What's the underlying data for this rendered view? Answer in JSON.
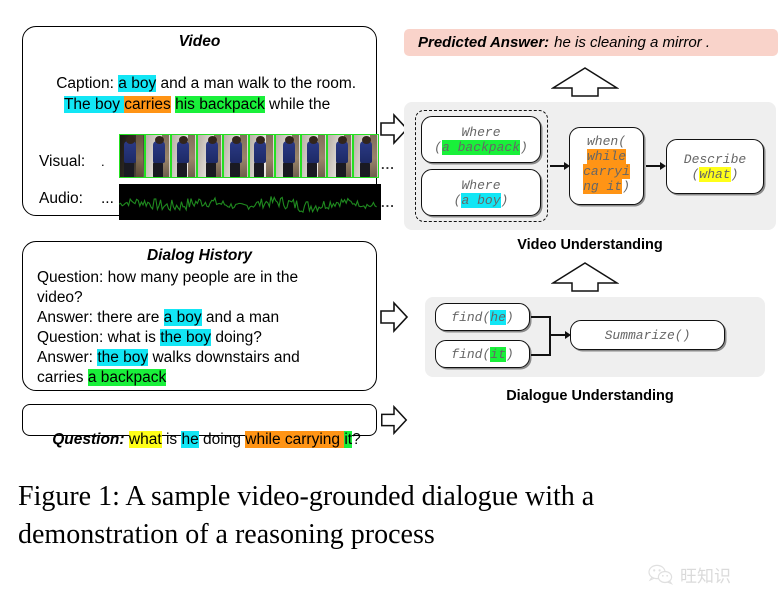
{
  "video_panel": {
    "title": "Video",
    "caption_label": "Caption:",
    "caption_line1_pre": "Caption: ",
    "caption_seg1": "a boy",
    "caption_seg2": " and a man walk to the room.",
    "caption_line2_seg1": "The boy ",
    "caption_line2_seg2": "carries",
    "caption_line2_seg3": " ",
    "caption_line2_seg4": "his backpack",
    "caption_line2_seg5": " while the",
    "visual_label": "Visual:",
    "visual_prefix_dots": ".",
    "visual_trailing_dots": "...",
    "audio_label": "Audio:",
    "audio_value": "...",
    "audio_trailing_dots": "..."
  },
  "dialog_panel": {
    "title": "Dialog History",
    "lines": [
      {
        "id": "q1",
        "prefix": "Question: how many people are in the"
      },
      {
        "id": "q1b",
        "prefix": "video?"
      },
      {
        "id": "a1",
        "prefix": "Answer: there are ",
        "hl": "a boy",
        "hl_color": "cyan",
        "suffix": " and a man"
      },
      {
        "id": "q2",
        "prefix": "Question: what is ",
        "hl": "the boy",
        "hl_color": "cyan",
        "suffix": " doing?"
      },
      {
        "id": "a2",
        "prefix": "Answer: ",
        "hl": "the boy",
        "hl_color": "cyan",
        "suffix": " walks downstairs and"
      },
      {
        "id": "a2b",
        "prefix": "carries ",
        "hl": "a backpack",
        "hl_color": "green",
        "suffix": ""
      }
    ]
  },
  "question_panel": {
    "label": "Question:",
    "seg_what": "what",
    "seg_is": " is ",
    "seg_he": "he",
    "seg_doing": " doing ",
    "seg_while": "while carrying ",
    "seg_it": "it",
    "seg_q": "?"
  },
  "predicted": {
    "label": "Predicted Answer:",
    "answer": "he is cleaning a mirror ."
  },
  "video_understanding": {
    "caption": "Video Understanding",
    "nodes": [
      {
        "id": "where-backpack",
        "line1": "Where",
        "line2_open": "(",
        "line2_hl": "a backpack",
        "line2_close": ")",
        "hl_color": "green"
      },
      {
        "id": "where-boy",
        "line1": "Where",
        "line2_open": "(",
        "line2_hl": "a boy",
        "line2_close": ")",
        "hl_color": "cyan"
      },
      {
        "id": "when",
        "l1": "when(",
        "l2": "while",
        "l3": "carryi",
        "l4": "ng it)",
        "hl_color": "orange"
      },
      {
        "id": "describe",
        "line1": "Describe",
        "line2_open": "(",
        "line2_hl": "what",
        "line2_close": ")",
        "hl_color": "yellow"
      }
    ]
  },
  "dialogue_understanding": {
    "caption": "Dialogue Understanding",
    "nodes": [
      {
        "id": "find-he",
        "pre": "find(",
        "hl": "he",
        "post": ")",
        "hl_color": "cyan"
      },
      {
        "id": "find-it",
        "pre": "find(",
        "hl": "it",
        "post": ")",
        "hl_color": "green"
      },
      {
        "id": "summarize",
        "text": "Summarize()"
      }
    ]
  },
  "figure_caption": {
    "line1": "Figure 1:  A sample video-grounded dialogue with a",
    "line2": "demonstration of a reasoning process"
  },
  "watermark": {
    "text": "旺知识",
    "icon": "wechat-icon"
  },
  "colors": {
    "cyan": "#12e6f5",
    "green": "#19f03a",
    "orange": "#ff9415",
    "yellow": "#ffff19",
    "pink": "#f9d3ca",
    "panel_gray": "#efefef",
    "node_text": "#666666",
    "waveform": "#1f8a1f"
  },
  "video_frames": {
    "count": 10
  }
}
